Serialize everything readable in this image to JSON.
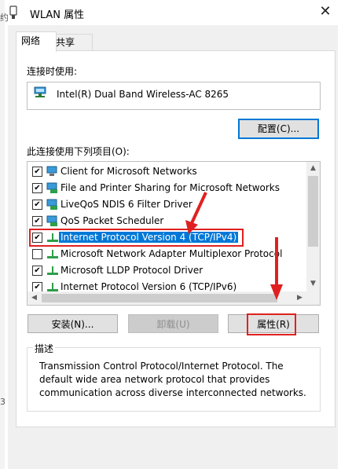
{
  "window": {
    "title": "WLAN 属性",
    "close_symbol": "✕"
  },
  "edge": {
    "top_char": "约",
    "bottom_char": "3"
  },
  "tabs": [
    {
      "label": "网络",
      "active": true
    },
    {
      "label": "共享",
      "active": false
    }
  ],
  "connect_using": {
    "label": "连接时使用:",
    "adapter": "Intel(R) Dual Band Wireless-AC 8265",
    "adapter_icon": "network-adapter-icon"
  },
  "configure_button": "配置(C)...",
  "items_label": "此连接使用下列项目(O):",
  "items": [
    {
      "label": "Client for Microsoft Networks",
      "checked": true,
      "icon": "network-client-icon",
      "selected": false
    },
    {
      "label": "File and Printer Sharing for Microsoft Networks",
      "checked": true,
      "icon": "network-service-icon",
      "selected": false
    },
    {
      "label": "LiveQoS NDIS 6 Filter Driver",
      "checked": true,
      "icon": "network-service-icon",
      "selected": false
    },
    {
      "label": "QoS Packet Scheduler",
      "checked": true,
      "icon": "network-service-icon",
      "selected": false
    },
    {
      "label": "Internet Protocol Version 4 (TCP/IPv4)",
      "checked": true,
      "icon": "network-protocol-icon",
      "selected": true
    },
    {
      "label": "Microsoft Network Adapter Multiplexor Protocol",
      "checked": false,
      "icon": "network-protocol-icon",
      "selected": false
    },
    {
      "label": "Microsoft LLDP Protocol Driver",
      "checked": true,
      "icon": "network-protocol-icon",
      "selected": false
    },
    {
      "label": "Internet Protocol Version 6 (TCP/IPv6)",
      "checked": true,
      "icon": "network-protocol-icon",
      "selected": false
    }
  ],
  "buttons": {
    "install": "安装(N)...",
    "uninstall": "卸载(U)",
    "properties": "属性(R)"
  },
  "description": {
    "title": "描述",
    "text": "Transmission Control Protocol/Internet Protocol. The default wide area network protocol that provides communication across diverse interconnected networks."
  },
  "colors": {
    "selection": "#0078d7",
    "annotation": "#e02020"
  }
}
